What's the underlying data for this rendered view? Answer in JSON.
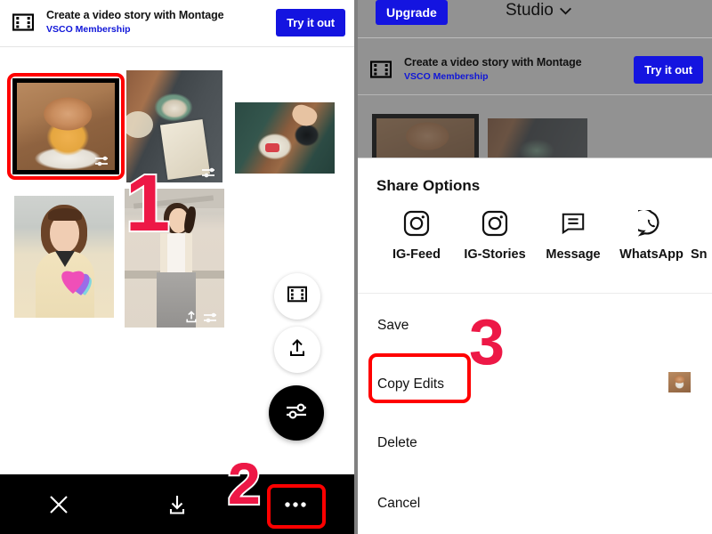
{
  "meta": {
    "app": "VSCO",
    "accent_blue": "#1414e0",
    "annotation_red": "#ed1846",
    "highlight_red": "#ff0000",
    "overlay_dim": "rgba(60,60,60,0.56)"
  },
  "left_panel": {
    "promo": {
      "icon": "film-strip-icon",
      "title": "Create a video story with Montage",
      "subtitle": "VSCO Membership",
      "button_label": "Try it out"
    },
    "photos": [
      {
        "id": "photo-latte",
        "alt": "Latte in a glass mug on a white saucer",
        "selected": true,
        "has_edit_badge": true,
        "has_upload_badge": false
      },
      {
        "id": "photo-cafe-table",
        "alt": "Cafe table with coffee cup and menu",
        "selected": false,
        "has_edit_badge": true,
        "has_upload_badge": false
      },
      {
        "id": "photo-tray",
        "alt": "Breakfast tray with cake and coffee",
        "selected": false,
        "has_edit_badge": false,
        "has_upload_badge": false
      },
      {
        "id": "photo-selfie",
        "alt": "Woman in cream blouse selfie with heart sticker",
        "selected": false,
        "has_edit_badge": false,
        "has_upload_badge": false
      },
      {
        "id": "photo-portrait",
        "alt": "Woman in white top and jeans standing by wall",
        "selected": false,
        "has_edit_badge": true,
        "has_upload_badge": true
      }
    ],
    "fabs": [
      {
        "id": "montage-fab",
        "icon": "film-strip-icon",
        "style": "white"
      },
      {
        "id": "share-fab",
        "icon": "upload-icon",
        "style": "white"
      },
      {
        "id": "edit-fab",
        "icon": "sliders-icon",
        "style": "black"
      }
    ],
    "bottom_bar": [
      {
        "id": "close-button",
        "icon": "close-icon"
      },
      {
        "id": "download-button",
        "icon": "download-icon"
      },
      {
        "id": "more-button",
        "icon": "ellipsis-icon"
      }
    ]
  },
  "right_panel": {
    "topbar": {
      "upgrade_label": "Upgrade",
      "studio_label": "Studio",
      "studio_chevron": "chevron-down-icon"
    },
    "promo": {
      "icon": "film-strip-icon",
      "title": "Create a video story with Montage",
      "subtitle": "VSCO Membership",
      "button_label": "Try it out"
    },
    "share_sheet": {
      "title": "Share Options",
      "share_targets": [
        {
          "id": "share-ig-feed",
          "label": "IG-Feed",
          "icon": "instagram-icon"
        },
        {
          "id": "share-ig-stories",
          "label": "IG-Stories",
          "icon": "instagram-icon"
        },
        {
          "id": "share-message",
          "label": "Message",
          "icon": "message-icon"
        },
        {
          "id": "share-whatsapp",
          "label": "WhatsApp",
          "icon": "whatsapp-icon"
        },
        {
          "id": "share-more",
          "label": "Sn",
          "icon": "snapchat-icon",
          "clipped": true
        }
      ],
      "menu": [
        {
          "id": "menu-save",
          "label": "Save",
          "highlighted": false,
          "thumbnail": false
        },
        {
          "id": "menu-copy-edits",
          "label": "Copy Edits",
          "highlighted": true,
          "thumbnail": true
        },
        {
          "id": "menu-delete",
          "label": "Delete",
          "highlighted": false,
          "thumbnail": false
        },
        {
          "id": "menu-cancel",
          "label": "Cancel",
          "highlighted": false,
          "thumbnail": false
        }
      ]
    }
  },
  "annotations": [
    {
      "id": "step-1",
      "label": "1"
    },
    {
      "id": "step-2",
      "label": "2"
    },
    {
      "id": "step-3",
      "label": "3"
    }
  ]
}
